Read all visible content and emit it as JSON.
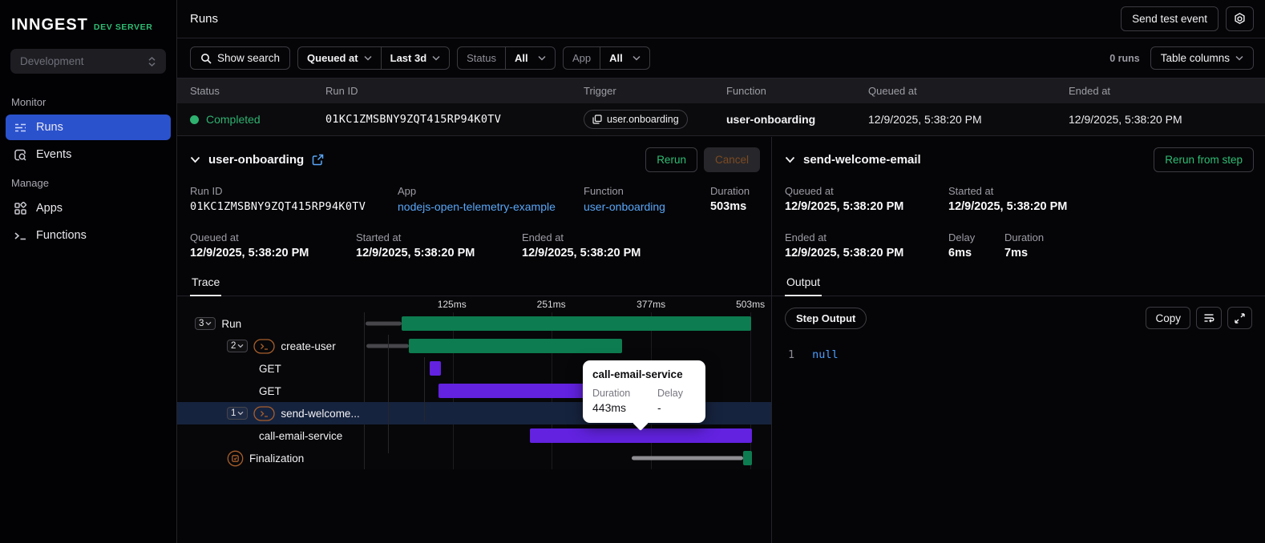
{
  "brand": {
    "logo": "INNGEST",
    "env_tag": "DEV SERVER"
  },
  "sidebar": {
    "workspace": "Development",
    "monitor_label": "Monitor",
    "manage_label": "Manage",
    "runs_label": "Runs",
    "events_label": "Events",
    "apps_label": "Apps",
    "functions_label": "Functions"
  },
  "header": {
    "title": "Runs",
    "send_test_event": "Send test event"
  },
  "filters": {
    "show_search": "Show search",
    "time_field": "Queued at",
    "time_range": "Last 3d",
    "status_label": "Status",
    "status_value": "All",
    "app_label": "App",
    "app_value": "All",
    "runs_count": "0 runs",
    "table_columns": "Table columns"
  },
  "table": {
    "columns": [
      "Status",
      "Run ID",
      "Trigger",
      "Function",
      "Queued at",
      "Ended at"
    ],
    "row": {
      "status": "Completed",
      "run_id": "01KC1ZMSBNY9ZQT415RP94K0TV",
      "trigger": "user.onboarding",
      "function": "user-onboarding",
      "queued_at": "12/9/2025, 5:38:20 PM",
      "ended_at": "12/9/2025, 5:38:20 PM"
    }
  },
  "run_panel": {
    "title": "user-onboarding",
    "rerun": "Rerun",
    "cancel": "Cancel",
    "run_id_label": "Run ID",
    "run_id": "01KC1ZMSBNY9ZQT415RP94K0TV",
    "app_label": "App",
    "app": "nodejs-open-telemetry-example",
    "function_label": "Function",
    "function": "user-onboarding",
    "duration_label": "Duration",
    "duration": "503ms",
    "queued_at_label": "Queued at",
    "queued_at": "12/9/2025, 5:38:20 PM",
    "started_at_label": "Started at",
    "started_at": "12/9/2025, 5:38:20 PM",
    "ended_at_label": "Ended at",
    "ended_at": "12/9/2025, 5:38:20 PM",
    "tab": "Trace"
  },
  "trace": {
    "ticks": [
      {
        "label": "125ms",
        "pos": 21.6
      },
      {
        "label": "251ms",
        "pos": 46.0
      },
      {
        "label": "377ms",
        "pos": 70.5
      },
      {
        "label": "503ms",
        "pos": 94.9
      }
    ],
    "rows": [
      {
        "name": "Run",
        "indent": 0,
        "badge": "3",
        "icon": null,
        "selected": false,
        "bars": [
          {
            "kind": "queue",
            "start": 0.3,
            "end": 9.2
          },
          {
            "kind": "span",
            "color": "green",
            "start": 9.2,
            "end": 95.1
          }
        ]
      },
      {
        "name": "create-user",
        "indent": 1,
        "badge": "2",
        "icon": "step-run-icon",
        "selected": false,
        "bars": [
          {
            "kind": "queue",
            "start": 0.5,
            "end": 11.0
          },
          {
            "kind": "span",
            "color": "green",
            "start": 11.0,
            "end": 63.3
          }
        ]
      },
      {
        "name": "GET",
        "indent": 2,
        "badge": null,
        "icon": null,
        "selected": false,
        "bars": [
          {
            "kind": "span",
            "color": "purple",
            "start": 16.1,
            "end": 18.9
          }
        ]
      },
      {
        "name": "GET",
        "indent": 2,
        "badge": null,
        "icon": null,
        "selected": false,
        "bars": [
          {
            "kind": "span",
            "color": "purple",
            "start": 18.3,
            "end": 57.5
          }
        ]
      },
      {
        "name": "send-welcome...",
        "indent": 1,
        "badge": "1",
        "icon": "step-run-icon",
        "selected": true,
        "bars": [
          {
            "kind": "span",
            "color": "green",
            "start": 64.4,
            "end": 68.2
          }
        ]
      },
      {
        "name": "call-email-service",
        "indent": 2,
        "badge": null,
        "icon": null,
        "selected": false,
        "bars": [
          {
            "kind": "span",
            "color": "purple",
            "start": 40.7,
            "end": 95.2
          }
        ]
      },
      {
        "name": "Finalization",
        "indent": 1,
        "badge": null,
        "icon": "finalization-icon",
        "selected": false,
        "bars": [
          {
            "kind": "gray",
            "start": 65.8,
            "end": 93.2
          },
          {
            "kind": "span",
            "color": "green",
            "start": 93.2,
            "end": 95.2
          }
        ]
      }
    ]
  },
  "tooltip": {
    "title": "call-email-service",
    "duration_label": "Duration",
    "duration": "443ms",
    "delay_label": "Delay",
    "delay": "-"
  },
  "step_panel": {
    "title": "send-welcome-email",
    "rerun_from_step": "Rerun from step",
    "queued_at_label": "Queued at",
    "queued_at": "12/9/2025, 5:38:20 PM",
    "started_at_label": "Started at",
    "started_at": "12/9/2025, 5:38:20 PM",
    "ended_at_label": "Ended at",
    "ended_at": "12/9/2025, 5:38:20 PM",
    "delay_label": "Delay",
    "delay": "6ms",
    "duration_label": "Duration",
    "duration": "7ms",
    "tab": "Output"
  },
  "output": {
    "badge": "Step Output",
    "copy": "Copy",
    "line_number": "1",
    "code": "null"
  },
  "colors": {
    "accent_green": "#2fbd74",
    "bar_green": "#0d7c50",
    "bar_purple": "#6222df",
    "link_blue": "#59a6f7",
    "selected_nav_blue": "#2b52cd",
    "selected_row_navy": "#16233e"
  }
}
